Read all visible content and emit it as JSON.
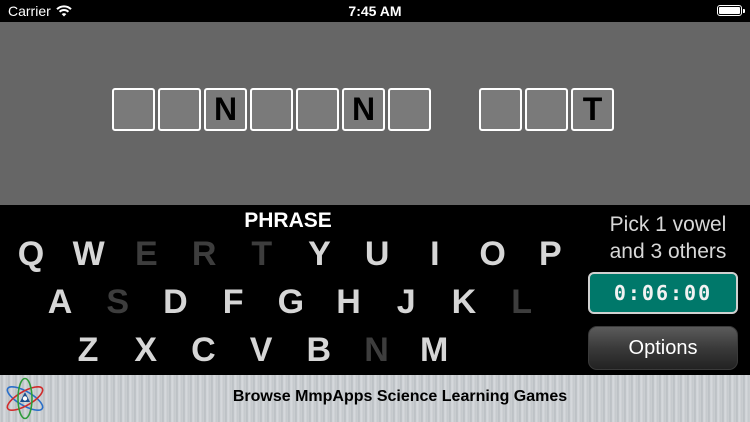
{
  "status": {
    "carrier": "Carrier",
    "time": "7:45 AM",
    "battery_level": 1.0
  },
  "board": {
    "words": [
      [
        "",
        "",
        "N",
        "",
        "",
        "N",
        ""
      ],
      [
        "",
        "",
        "T"
      ]
    ]
  },
  "category": "PHRASE",
  "keyboard": {
    "rows": [
      [
        {
          "letter": "Q",
          "state": "active"
        },
        {
          "letter": "W",
          "state": "active"
        },
        {
          "letter": "E",
          "state": "used"
        },
        {
          "letter": "R",
          "state": "used"
        },
        {
          "letter": "T",
          "state": "used"
        },
        {
          "letter": "Y",
          "state": "active"
        },
        {
          "letter": "U",
          "state": "active"
        },
        {
          "letter": "I",
          "state": "active"
        },
        {
          "letter": "O",
          "state": "active"
        },
        {
          "letter": "P",
          "state": "active"
        }
      ],
      [
        {
          "letter": "A",
          "state": "active"
        },
        {
          "letter": "S",
          "state": "used"
        },
        {
          "letter": "D",
          "state": "active"
        },
        {
          "letter": "F",
          "state": "active"
        },
        {
          "letter": "G",
          "state": "active"
        },
        {
          "letter": "H",
          "state": "active"
        },
        {
          "letter": "J",
          "state": "active"
        },
        {
          "letter": "K",
          "state": "active"
        },
        {
          "letter": "L",
          "state": "used"
        }
      ],
      [
        {
          "letter": "Z",
          "state": "active"
        },
        {
          "letter": "X",
          "state": "active"
        },
        {
          "letter": "C",
          "state": "active"
        },
        {
          "letter": "V",
          "state": "active"
        },
        {
          "letter": "B",
          "state": "active"
        },
        {
          "letter": "N",
          "state": "used"
        },
        {
          "letter": "M",
          "state": "active"
        }
      ]
    ]
  },
  "instruction": {
    "line1": "Pick 1 vowel",
    "line2": "and 3 others"
  },
  "timer": "0:06:00",
  "options_label": "Options",
  "banner": {
    "text": "Browse MmpApps Science Learning Games",
    "logo_icon": "atom-logo-icon"
  },
  "colors": {
    "board": "#666666",
    "timer": "#00786a",
    "key_used": "#3d3d3d",
    "key_active": "#d6d6d6"
  }
}
